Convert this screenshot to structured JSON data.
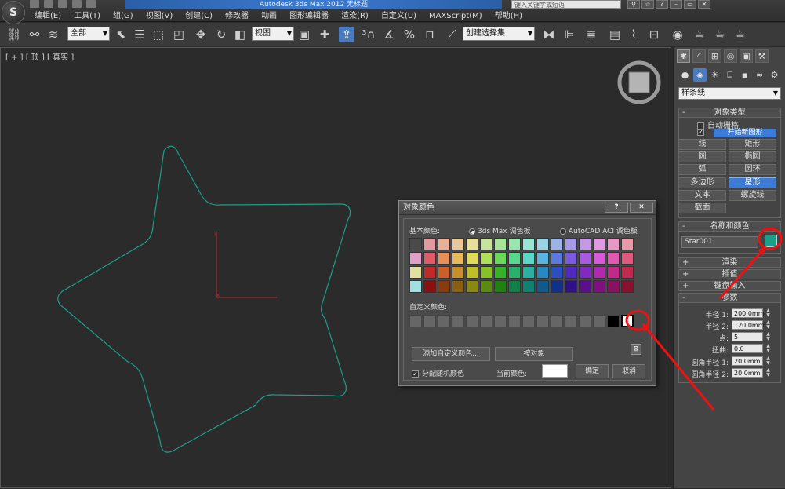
{
  "window": {
    "title": "Autodesk 3ds Max  2012      无标题",
    "search_placeholder": "键入关键字或短语"
  },
  "menu": [
    "编辑(E)",
    "工具(T)",
    "组(G)",
    "视图(V)",
    "创建(C)",
    "修改器",
    "动画",
    "图形编辑器",
    "渲染(R)",
    "自定义(U)",
    "MAXScript(M)",
    "帮助(H)"
  ],
  "toolbar": {
    "selection_filter": "全部",
    "reference_coord": "视图",
    "named_selection": "创建选择集"
  },
  "viewport": {
    "label": "[ + ] [ 顶 ] [ 真实 ]",
    "shape_color": "#1aa08a",
    "axis_color": "#b0303a"
  },
  "command_panel": {
    "category": "样条线",
    "object_type": {
      "header": "对象类型",
      "auto_grid": "自动栅格",
      "start_new_shape": "开始新图形",
      "buttons": [
        "线",
        "矩形",
        "圆",
        "椭圆",
        "弧",
        "圆环",
        "多边形",
        "星形",
        "文本",
        "螺旋线",
        "截面"
      ]
    },
    "name_and_color": {
      "header": "名称和颜色",
      "name": "Star001",
      "color": "#1aa08a"
    },
    "rollouts": {
      "rendering": "渲染",
      "interpolation": "插值",
      "keyboard_entry": "键盘输入",
      "parameters": "参数"
    },
    "params": [
      {
        "label": "半径 1:",
        "value": "200.0mm"
      },
      {
        "label": "半径 2:",
        "value": "120.0mm"
      },
      {
        "label": "点:",
        "value": "5"
      },
      {
        "label": "扭曲:",
        "value": "0.0"
      },
      {
        "label": "圆角半径 1:",
        "value": "20.0mm"
      },
      {
        "label": "圆角半径 2:",
        "value": "20.0mm"
      }
    ]
  },
  "dialog": {
    "title": "对象颜色",
    "help": "?",
    "close": "✕",
    "basic_colors": "基本颜色:",
    "palette_max": "3ds Max 调色板",
    "palette_aci": "AutoCAD ACI 调色板",
    "custom_colors": "自定义颜色:",
    "add_custom": "添加自定义颜色...",
    "by_object": "按对象",
    "assign_random": "分配随机颜色",
    "current_color": "当前颜色:",
    "ok": "确定",
    "cancel": "取消",
    "palette_rows": [
      [
        "#4a4a4a",
        "#e09aa0",
        "#e8b09a",
        "#e8c89a",
        "#e8e09a",
        "#c8e49a",
        "#a8e49a",
        "#9ae4b0",
        "#9ae4d4",
        "#9ad4e4",
        "#9ab4e8",
        "#a89ae8",
        "#c49ae8",
        "#e09ae0",
        "#e49ac4",
        "#e49aa8"
      ],
      [
        "#e0a0c8",
        "#e05a6a",
        "#e8905a",
        "#e8b85a",
        "#e0dc5a",
        "#b0e05a",
        "#6ad85a",
        "#5ad88c",
        "#5ad8c8",
        "#5ab4e0",
        "#5a7ae0",
        "#7a5ae0",
        "#a85ae0",
        "#d85ad8",
        "#e05ab0",
        "#e05a80"
      ],
      [
        "#e0e0a0",
        "#c02a2a",
        "#c8602a",
        "#c8902a",
        "#c0bc2a",
        "#88c02a",
        "#3ab02a",
        "#2ab06a",
        "#2ab0a0",
        "#2a88c0",
        "#2a50c0",
        "#502ac0",
        "#802ac0",
        "#b02ab0",
        "#c02a88",
        "#c02a50"
      ],
      [
        "#a0e0e0",
        "#8a1010",
        "#8a3a10",
        "#8a6010",
        "#8a8810",
        "#5a8a10",
        "#208010",
        "#108048",
        "#108070",
        "#105a8a",
        "#10308a",
        "#30108a",
        "#5a108a",
        "#801080",
        "#8a1060",
        "#8a1030"
      ]
    ]
  }
}
